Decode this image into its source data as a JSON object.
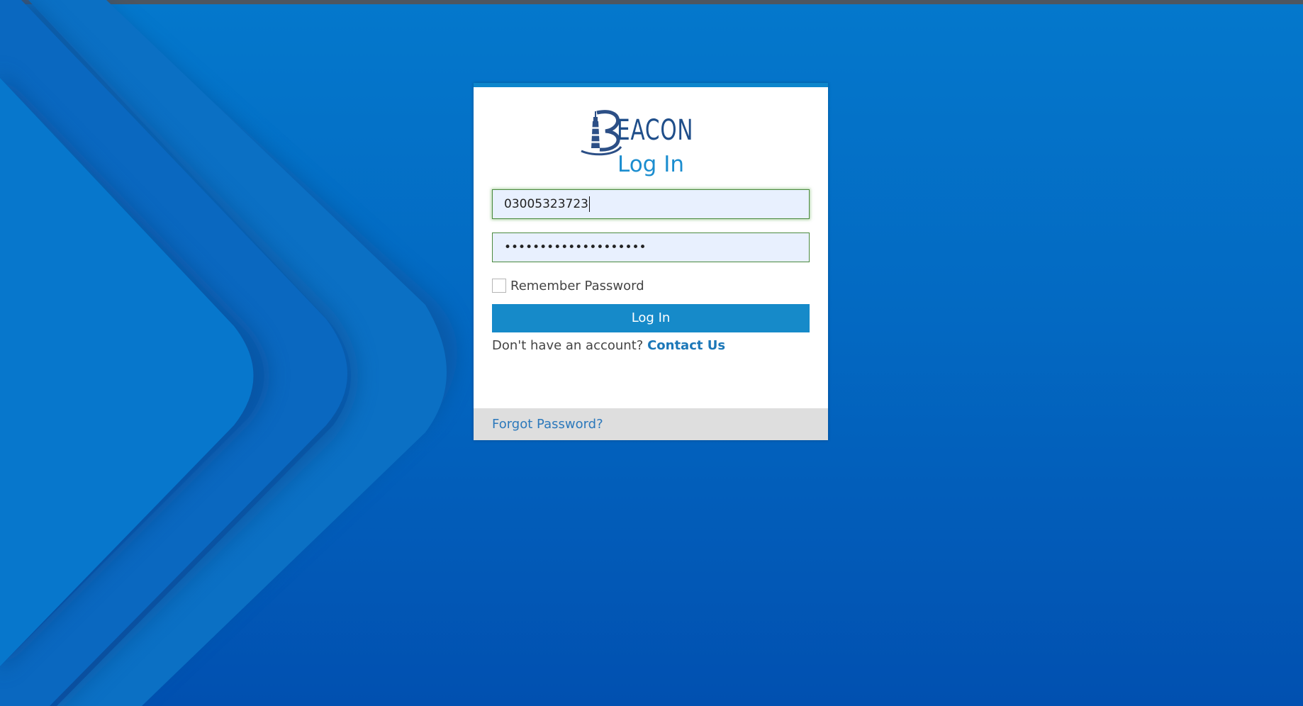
{
  "brand": {
    "logo_text": "EACON",
    "logo_initial": "B",
    "colors": {
      "background_top": "#0478cc",
      "background_bottom": "#0150b0",
      "accent": "#168ac9",
      "title": "#1b8dcf",
      "link": "#2b78bb",
      "logo": "#1f4e8a"
    }
  },
  "login": {
    "title": "Log In",
    "username_value": "03005323723",
    "password_value": "••••••••••••••••••••",
    "remember_label": "Remember Password",
    "remember_checked": false,
    "submit_label": "Log In",
    "no_account_text": "Don't have an account?",
    "contact_link": "Contact Us",
    "forgot_link": "Forgot Password?"
  },
  "icons": {
    "logo": "beacon-lighthouse-logo-icon"
  }
}
